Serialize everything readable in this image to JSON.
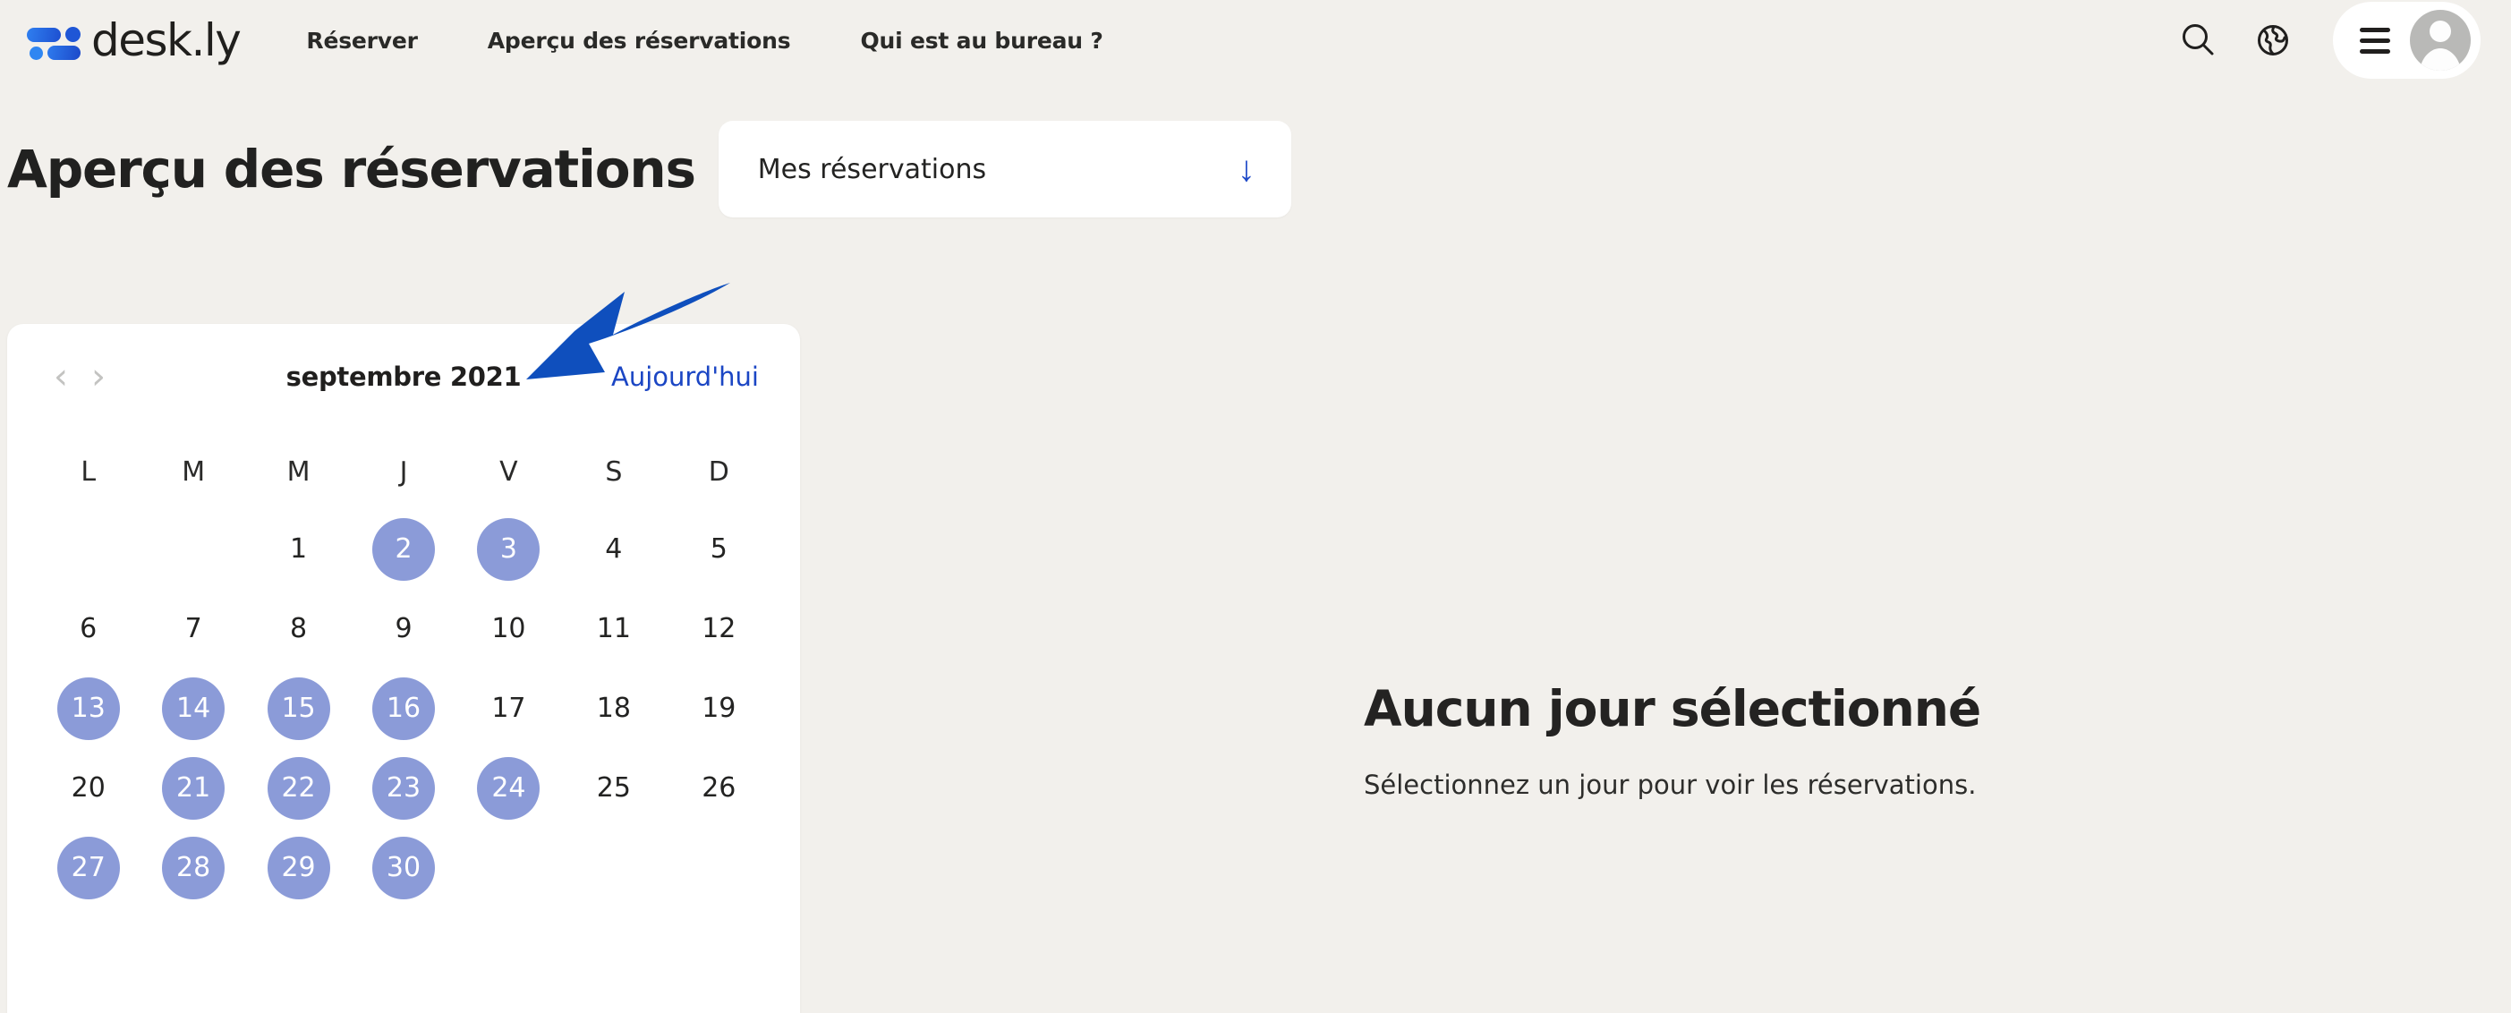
{
  "header": {
    "logo_text": "desk.ly",
    "logo_icon": "deskly-people-logo",
    "nav": [
      {
        "label": "Réserver",
        "name": "nav-reserver"
      },
      {
        "label": "Aperçu des réservations",
        "name": "nav-apercu-des-reservations"
      },
      {
        "label": "Qui est au bureau ?",
        "name": "nav-qui-est-au-bureau"
      }
    ],
    "actions": {
      "search_icon": "search-icon",
      "language_icon": "globe-icon",
      "menu_icon": "hamburger-menu-icon",
      "avatar_icon": "user-avatar-icon"
    }
  },
  "page": {
    "title": "Aperçu des réservations",
    "scope_select": {
      "value": "Mes réservations",
      "arrow_glyph": "↓",
      "arrow_icon": "arrow-down-icon"
    }
  },
  "calendar": {
    "prev_glyph": "‹",
    "next_glyph": "›",
    "prev_icon": "chevron-left-icon",
    "next_icon": "chevron-right-icon",
    "month_label": "septembre 2021",
    "today_label": "Aujourd'hui",
    "weekdays": [
      "L",
      "M",
      "M",
      "J",
      "V",
      "S",
      "D"
    ],
    "leading_blanks": 2,
    "days": [
      {
        "n": "1",
        "booked": false
      },
      {
        "n": "2",
        "booked": true
      },
      {
        "n": "3",
        "booked": true
      },
      {
        "n": "4",
        "booked": false
      },
      {
        "n": "5",
        "booked": false
      },
      {
        "n": "6",
        "booked": false
      },
      {
        "n": "7",
        "booked": false
      },
      {
        "n": "8",
        "booked": false
      },
      {
        "n": "9",
        "booked": false
      },
      {
        "n": "10",
        "booked": false
      },
      {
        "n": "11",
        "booked": false
      },
      {
        "n": "12",
        "booked": false
      },
      {
        "n": "13",
        "booked": true
      },
      {
        "n": "14",
        "booked": true
      },
      {
        "n": "15",
        "booked": true
      },
      {
        "n": "16",
        "booked": true
      },
      {
        "n": "17",
        "booked": false
      },
      {
        "n": "18",
        "booked": false
      },
      {
        "n": "19",
        "booked": false
      },
      {
        "n": "20",
        "booked": false
      },
      {
        "n": "21",
        "booked": true
      },
      {
        "n": "22",
        "booked": true
      },
      {
        "n": "23",
        "booked": true
      },
      {
        "n": "24",
        "booked": true
      },
      {
        "n": "25",
        "booked": false
      },
      {
        "n": "26",
        "booked": false
      },
      {
        "n": "27",
        "booked": true
      },
      {
        "n": "28",
        "booked": true
      },
      {
        "n": "29",
        "booked": true
      },
      {
        "n": "30",
        "booked": true
      }
    ]
  },
  "empty_state": {
    "title": "Aucun jour sélectionné",
    "subtitle": "Sélectionnez un jour pour voir les réservations."
  },
  "annotation": {
    "arrow_icon": "annotation-arrow-pointing-left",
    "color": "#0f4fbd"
  },
  "colors": {
    "page_background": "#f2f0ec",
    "card_background": "#ffffff",
    "booked_day": "#8b9bd8",
    "link_blue": "#1b46c4",
    "text_dark": "#212120",
    "chevron_grey": "#c3c3c1"
  }
}
